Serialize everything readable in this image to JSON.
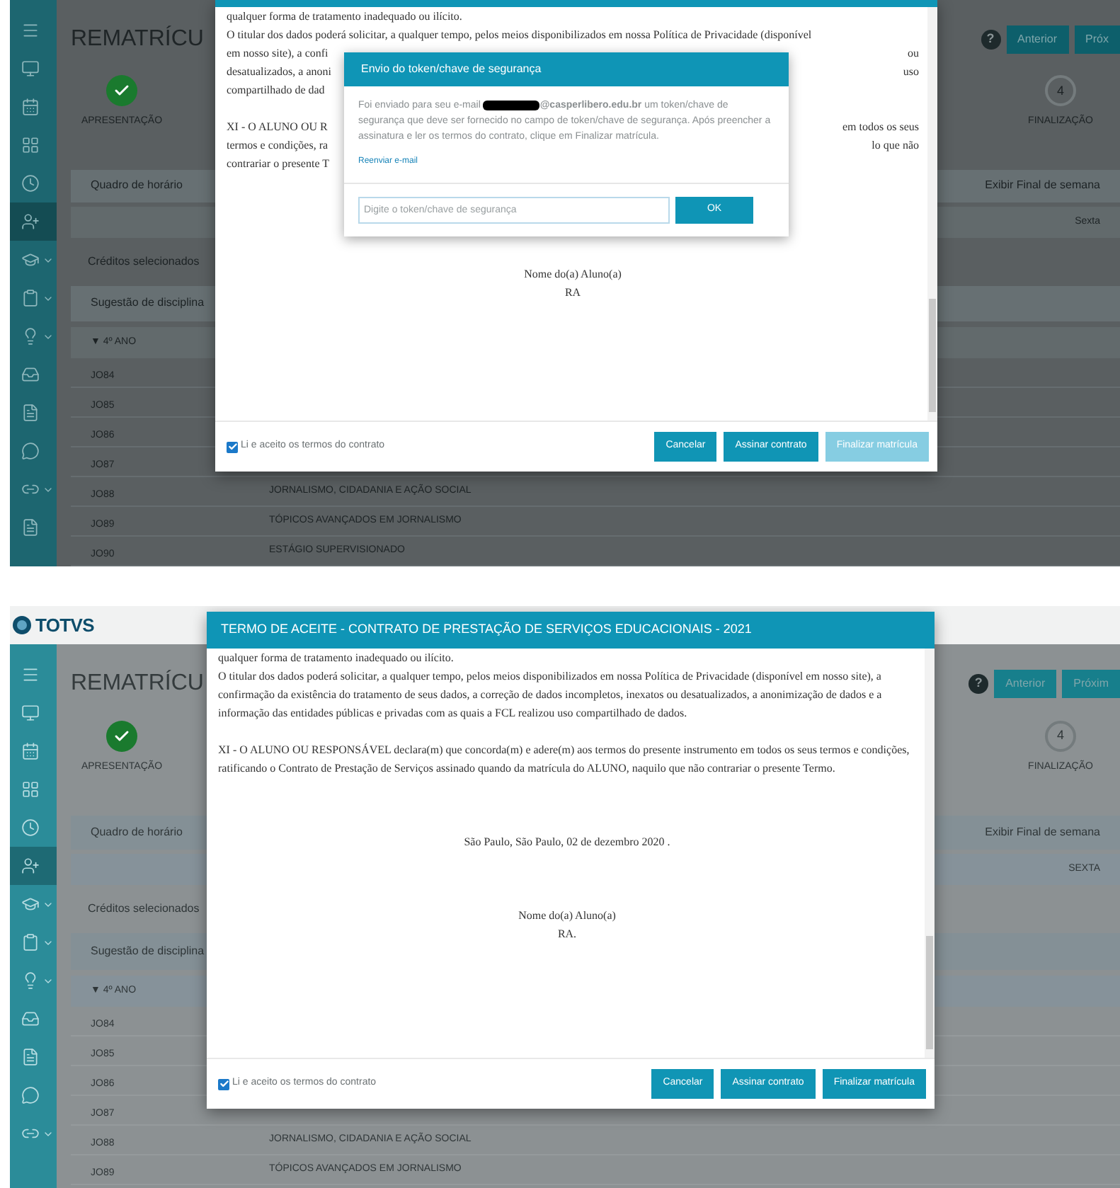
{
  "screens": [
    {
      "page": {
        "title": "REMATRÍCU",
        "help": "?",
        "buttons": [
          "Anterior",
          "Próx"
        ],
        "steps": [
          {
            "label": "APRESENTAÇÃO",
            "done": true
          },
          {
            "label": "FINALIZAÇÃO",
            "number": "4",
            "done": false
          }
        ],
        "schedule_title": "Quadro de horário",
        "weekend_toggle": "Exibir Final de semana",
        "day": "Sexta",
        "credits": "Créditos selecionados",
        "suggestion_title": "Sugestão de disciplina",
        "group": "▼ 4º ANO",
        "rows": [
          {
            "code": "JO84"
          },
          {
            "code": "JO85"
          },
          {
            "code": "JO86"
          },
          {
            "code": "JO87"
          },
          {
            "code": "JO88",
            "name": "JORNALISMO, CIDADANIA E AÇÃO SOCIAL"
          },
          {
            "code": "JO89",
            "name": "TÓPICOS AVANÇADOS EM JORNALISMO"
          },
          {
            "code": "JO90",
            "name": "ESTÁGIO SUPERVISIONADO"
          }
        ]
      },
      "sidebar": [
        {
          "selected": false,
          "submenu": false
        },
        {
          "selected": false,
          "submenu": false
        },
        {
          "selected": false,
          "submenu": false
        },
        {
          "selected": false,
          "submenu": false
        },
        {
          "selected": false,
          "submenu": false
        },
        {
          "selected": true,
          "submenu": false
        },
        {
          "selected": false,
          "submenu": true
        },
        {
          "selected": false,
          "submenu": true
        },
        {
          "selected": false,
          "submenu": true
        },
        {
          "selected": false,
          "submenu": false
        },
        {
          "selected": false,
          "submenu": false
        },
        {
          "selected": false,
          "submenu": false
        },
        {
          "selected": false,
          "submenu": true
        },
        {
          "selected": false,
          "submenu": false
        }
      ],
      "modal": {
        "document": [
          {
            "kind": "line",
            "left": "qualquer forma de tratamento inadequado ou ilícito."
          },
          {
            "kind": "line",
            "left": "O titular dos dados poderá solicitar, a qualquer tempo, pelos meios disponibilizados em nossa Política de Privacidade (disponível"
          },
          {
            "kind": "line",
            "left": "em nosso site), a confi",
            "right": "ou"
          },
          {
            "kind": "line",
            "left": "desatualizados, a anoni",
            "right": "uso"
          },
          {
            "kind": "line",
            "left": "compartilhado de dad"
          },
          {
            "kind": "spacer"
          },
          {
            "kind": "line",
            "left": "XI - O ALUNO OU R",
            "right": "em todos os seus"
          },
          {
            "kind": "line",
            "left": "termos e condições, ra",
            "right": "lo que não"
          },
          {
            "kind": "line",
            "left": "contrariar o presente T"
          },
          {
            "kind": "spacer"
          },
          {
            "kind": "spacer"
          },
          {
            "kind": "spacer"
          },
          {
            "kind": "spacer"
          },
          {
            "kind": "spacer"
          },
          {
            "kind": "centered",
            "text": "Nome do(a) Aluno(a)"
          },
          {
            "kind": "centered",
            "text": "RA"
          }
        ],
        "accept": {
          "label": "Li e aceito os termos do contrato",
          "checked": true
        },
        "buttons": [
          {
            "label": "Cancelar",
            "disabled": false
          },
          {
            "label": "Assinar contrato",
            "disabled": false
          },
          {
            "label": "Finalizar matrícula",
            "disabled": true
          }
        ],
        "token_dialog": {
          "title": "Envio do token/chave de segurança",
          "message_before": "Foi enviado para seu e-mail",
          "message_after": "**@casperlibero.edu.br** um token/chave de segurança que deve ser fornecido no campo de token/chave de segurança. Após preencher a assinatura e ler os termos do contrato, clique em Finalizar matrícula.",
          "link": "Reenviar e-mail",
          "placeholder": "Digite o token/chave de segurança",
          "button": "OK"
        }
      }
    },
    {
      "header": {
        "logo": "TOTVS"
      },
      "page": {
        "title": "REMATRÍCU",
        "help": "?",
        "buttons": [
          "Anterior",
          "Próxim"
        ],
        "steps": [
          {
            "label": "APRESENTAÇÃO",
            "done": true
          },
          {
            "label": "FINALIZAÇÃO",
            "number": "4",
            "done": false
          }
        ],
        "schedule_title": "Quadro de horário",
        "weekend_toggle": "Exibir Final de semana",
        "day": "SEXTA",
        "credits": "Créditos selecionados",
        "suggestion_title": "Sugestão de disciplina",
        "group": "▼ 4º ANO",
        "rows": [
          {
            "code": "JO84"
          },
          {
            "code": "JO85"
          },
          {
            "code": "JO86"
          },
          {
            "code": "JO87"
          },
          {
            "code": "JO88",
            "name": "JORNALISMO, CIDADANIA E AÇÃO SOCIAL"
          },
          {
            "code": "JO89",
            "name": "TÓPICOS AVANÇADOS EM JORNALISMO"
          }
        ]
      },
      "sidebar": [
        {
          "selected": false,
          "submenu": false
        },
        {
          "selected": false,
          "submenu": false
        },
        {
          "selected": false,
          "submenu": false
        },
        {
          "selected": false,
          "submenu": false
        },
        {
          "selected": false,
          "submenu": false
        },
        {
          "selected": true,
          "submenu": false
        },
        {
          "selected": false,
          "submenu": true
        },
        {
          "selected": false,
          "submenu": true
        },
        {
          "selected": false,
          "submenu": true
        },
        {
          "selected": false,
          "submenu": false
        },
        {
          "selected": false,
          "submenu": false
        },
        {
          "selected": false,
          "submenu": false
        },
        {
          "selected": false,
          "submenu": true
        }
      ],
      "modal": {
        "title": "TERMO DE ACEITE - CONTRATO DE PRESTAÇÃO DE SERVIÇOS EDUCACIONAIS - 2021",
        "document": [
          {
            "kind": "line",
            "left": "qualquer forma de tratamento inadequado ou ilícito."
          },
          {
            "kind": "paragraph",
            "text": "O titular dos dados poderá solicitar, a qualquer tempo, pelos meios disponibilizados em nossa Política de Privacidade (disponível em nosso site), a confirmação da existência do tratamento de seus dados, a correção de dados incompletos, inexatos ou desatualizados, a anonimização de dados e a informação das entidades públicas e privadas com as quais a FCL realizou uso compartilhado de dados."
          },
          {
            "kind": "spacer"
          },
          {
            "kind": "paragraph",
            "text": "XI - O ALUNO OU RESPONSÁVEL declara(m) que concorda(m) e adere(m) aos termos do presente instrumento em todos os seus termos e condições, ratificando o Contrato de Prestação de Serviços assinado quando da matrícula do ALUNO, naquilo que não contrariar o presente Termo."
          },
          {
            "kind": "spacer"
          },
          {
            "kind": "spacer"
          },
          {
            "kind": "spacer"
          },
          {
            "kind": "centered",
            "text": "São Paulo, São Paulo, 02 de dezembro 2020 ."
          },
          {
            "kind": "spacer"
          },
          {
            "kind": "spacer"
          },
          {
            "kind": "spacer"
          },
          {
            "kind": "centered",
            "text": "Nome do(a) Aluno(a)"
          },
          {
            "kind": "centered",
            "text": "RA."
          }
        ],
        "accept": {
          "label": "Li e aceito os termos do contrato",
          "checked": true
        },
        "buttons": [
          {
            "label": "Cancelar",
            "disabled": false
          },
          {
            "label": "Assinar contrato",
            "disabled": false
          },
          {
            "label": "Finalizar matrícula",
            "disabled": false
          }
        ]
      }
    }
  ]
}
